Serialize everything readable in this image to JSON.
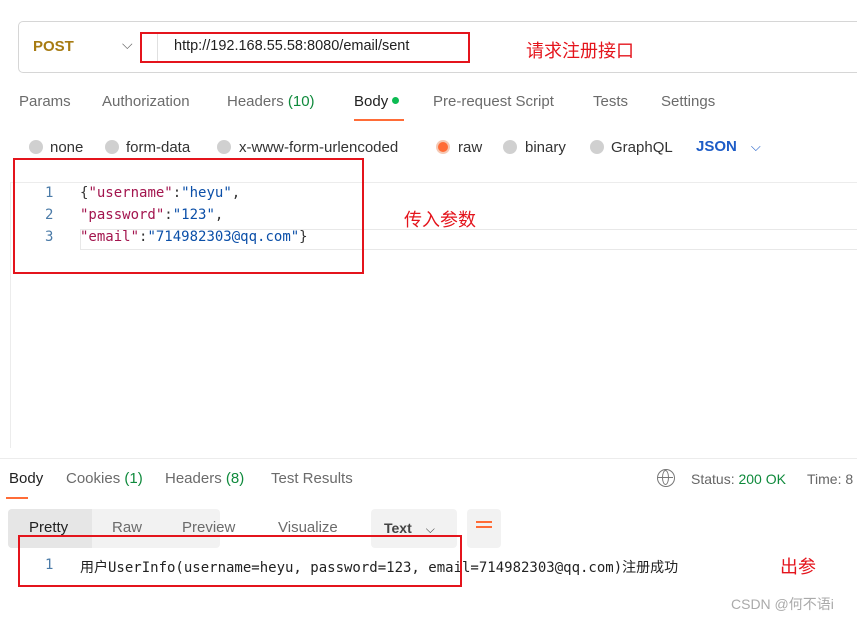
{
  "request": {
    "method": "POST",
    "url": "http://192.168.55.58:8080/email/sent"
  },
  "annotations": {
    "url": "请求注册接口",
    "body": "传入参数",
    "response": "出参"
  },
  "tabs": [
    {
      "label": "Params"
    },
    {
      "label": "Authorization"
    },
    {
      "label": "Headers",
      "count": "(10)"
    },
    {
      "label": "Body"
    },
    {
      "label": "Pre-request Script"
    },
    {
      "label": "Tests"
    },
    {
      "label": "Settings"
    }
  ],
  "body_types": [
    "none",
    "form-data",
    "x-www-form-urlencoded",
    "raw",
    "binary",
    "GraphQL"
  ],
  "selected_body_type": "raw",
  "format": "JSON",
  "editor": {
    "lines": [
      {
        "n": "1",
        "parts": [
          [
            "",
            "{"
          ],
          [
            "key",
            "\"username\""
          ],
          [
            "",
            ":"
          ],
          [
            "str",
            "\"heyu\""
          ],
          [
            "",
            ","
          ]
        ]
      },
      {
        "n": "2",
        "parts": [
          [
            "key",
            "\"password\""
          ],
          [
            "",
            ":"
          ],
          [
            "str",
            "\"123\""
          ],
          [
            "",
            ","
          ]
        ]
      },
      {
        "n": "3",
        "parts": [
          [
            "key",
            "\"email\""
          ],
          [
            "",
            ":"
          ],
          [
            "str",
            "\"714982303@qq.com\""
          ],
          [
            "",
            "}"
          ]
        ]
      }
    ]
  },
  "response": {
    "tabs": [
      {
        "label": "Body"
      },
      {
        "label": "Cookies",
        "count": "(1)"
      },
      {
        "label": "Headers",
        "count": "(8)"
      },
      {
        "label": "Test Results"
      }
    ],
    "status_label": "Status:",
    "status": "200 OK",
    "time_label": "Time: 8",
    "views": [
      "Pretty",
      "Raw",
      "Preview",
      "Visualize"
    ],
    "view_format": "Text",
    "line_no": "1",
    "output": "用户UserInfo(username=heyu, password=123, email=714982303@qq.com)注册成功"
  },
  "watermark": "CSDN @何不语i",
  "colors": {
    "accent": "#ff6c37",
    "status_green": "#0f8a3c",
    "json_blue": "#1d5cc7",
    "annotation_red": "#e4141c"
  }
}
